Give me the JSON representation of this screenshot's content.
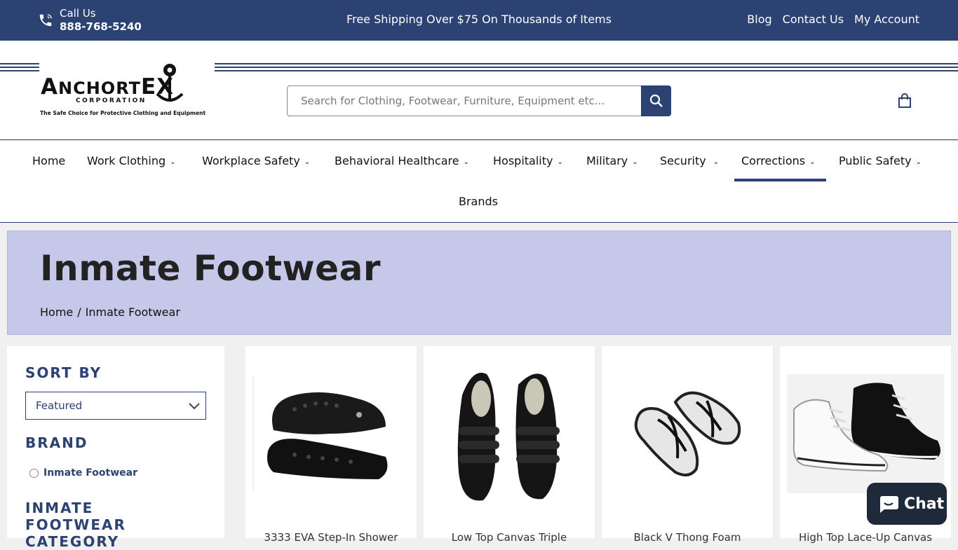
{
  "topbar": {
    "call_label": "Call Us",
    "phone": "888-768-5240",
    "promo": "Free Shipping Over $75 On Thousands of Items",
    "links": [
      "Blog",
      "Contact Us",
      "My Account"
    ]
  },
  "header": {
    "logo_name": "ANCHORTEX",
    "logo_sub": "CORPORATION",
    "logo_tagline": "The Safe Choice for Protective Clothing and Equipment",
    "search_placeholder": "Search for Clothing, Footwear, Furniture, Equipment etc..."
  },
  "nav": {
    "items": [
      "Home",
      "Work Clothing",
      "Workplace Safety",
      "Behavioral Healthcare",
      "Hospitality",
      "Military",
      "Security",
      "Corrections",
      "Public Safety",
      "Brands"
    ],
    "active": "Corrections"
  },
  "banner": {
    "title": "Inmate Footwear",
    "breadcrumb": [
      "Home",
      "/",
      "Inmate Footwear"
    ]
  },
  "sidebar": {
    "sort_heading": "SORT BY",
    "sort_value": "Featured",
    "brand_heading": "BRAND",
    "brand_option": "Inmate Footwear",
    "category_heading": "INMATE FOOTWEAR CATEGORY"
  },
  "products": [
    {
      "title": "3333 EVA Step-In Shower"
    },
    {
      "title": "Low Top Canvas Triple"
    },
    {
      "title": "Black V Thong Foam"
    },
    {
      "title": "High Top Lace-Up Canvas"
    }
  ],
  "chat": {
    "label": "Chat"
  },
  "colors": {
    "brand": "#2c4272",
    "banner": "#c5c8e8",
    "chat": "#1e2a3a"
  }
}
